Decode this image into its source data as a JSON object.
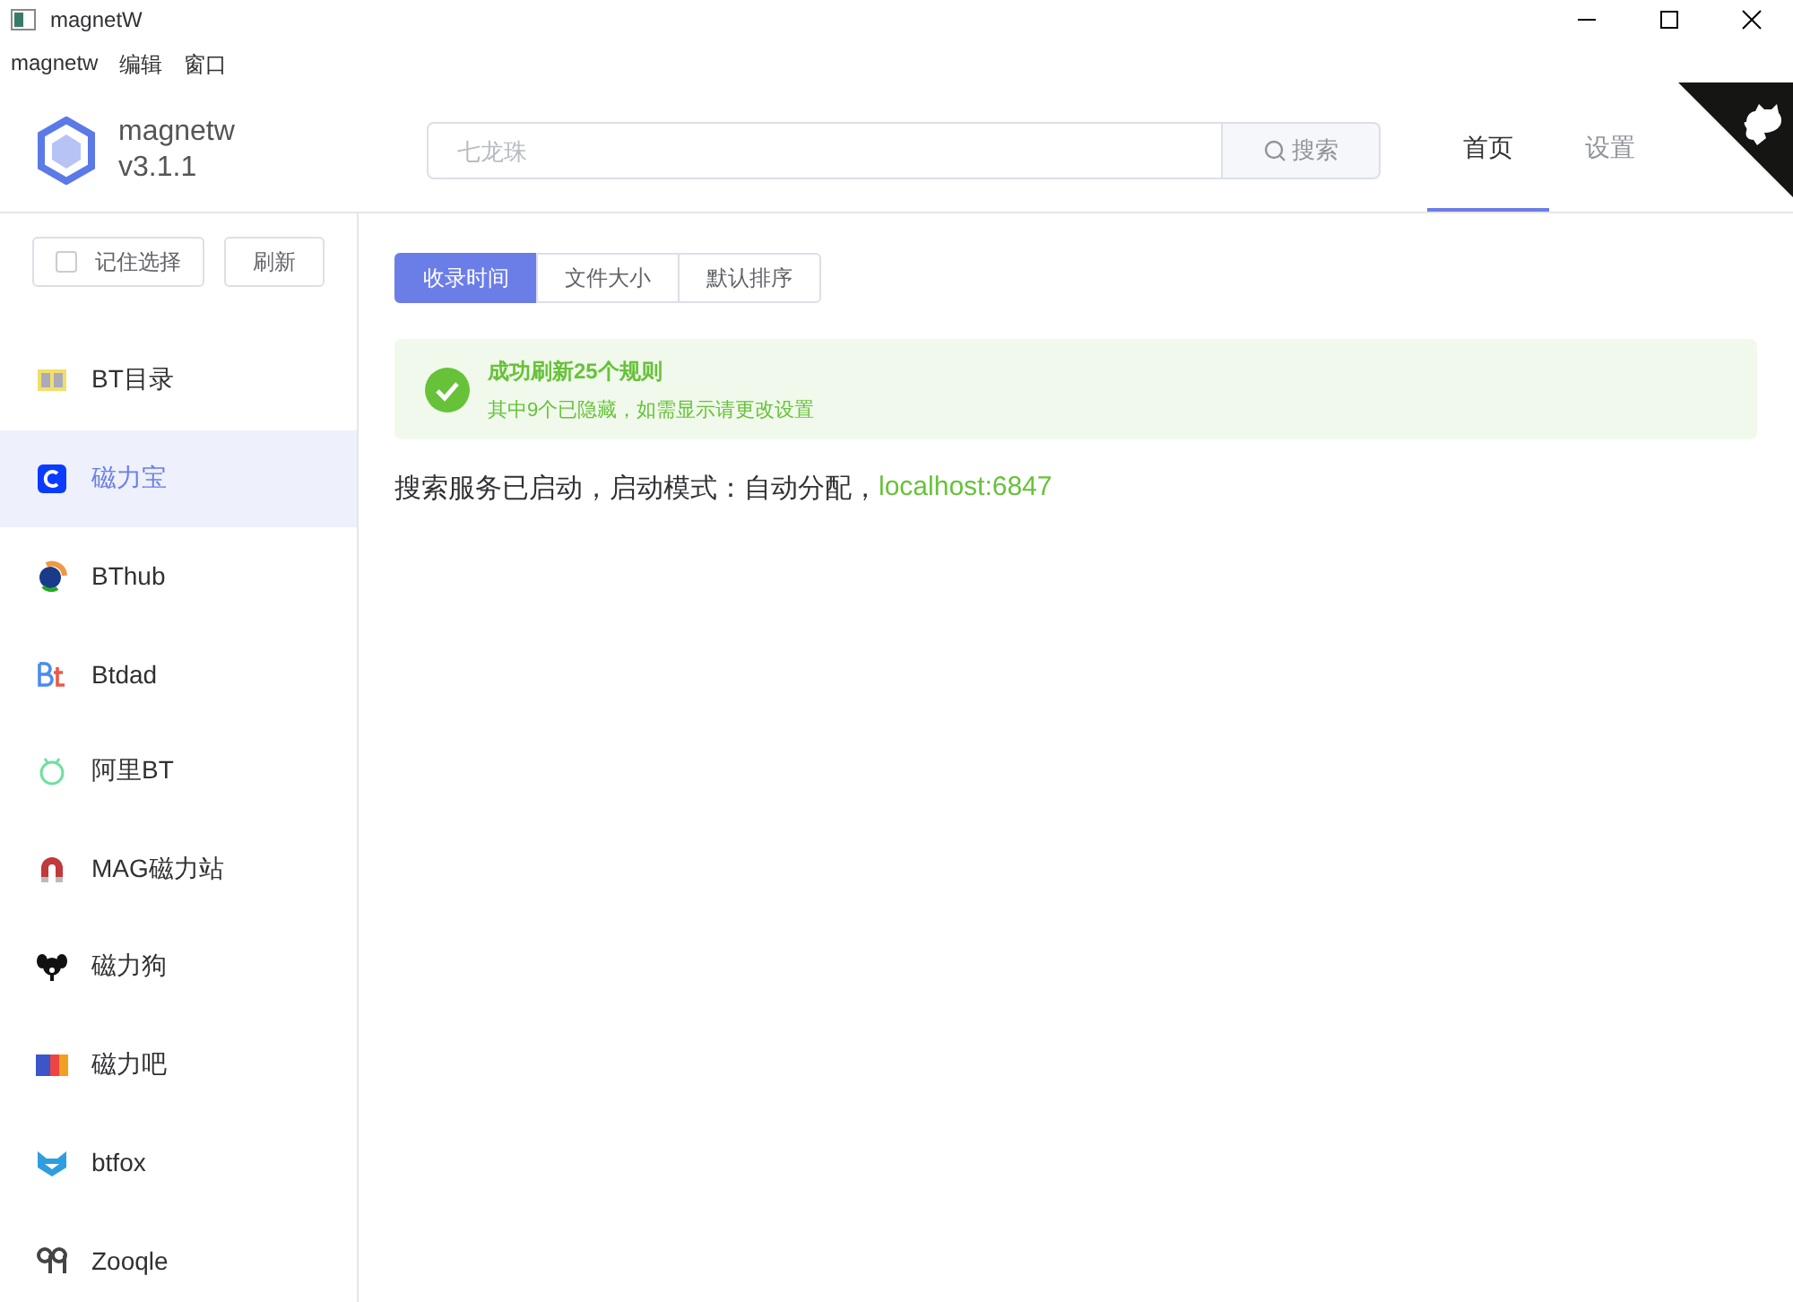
{
  "window": {
    "title": "magnetW"
  },
  "menu": [
    "magnetw",
    "编辑",
    "窗口"
  ],
  "app": {
    "name": "magnetw",
    "version": "v3.1.1"
  },
  "search": {
    "placeholder": "七龙珠",
    "button": "搜索"
  },
  "nav": [
    {
      "label": "首页",
      "selected": true
    },
    {
      "label": "设置",
      "selected": false
    }
  ],
  "sidebar": {
    "remember": {
      "label": "记住选择",
      "checked": false
    },
    "refresh": "刷新",
    "items": [
      {
        "label": "BT目录",
        "selected": false
      },
      {
        "label": "磁力宝",
        "selected": true
      },
      {
        "label": "BThub",
        "selected": false
      },
      {
        "label": "Btdad",
        "selected": false
      },
      {
        "label": "阿里BT",
        "selected": false
      },
      {
        "label": "MAG磁力站",
        "selected": false
      },
      {
        "label": "磁力狗",
        "selected": false
      },
      {
        "label": "磁力吧",
        "selected": false
      },
      {
        "label": "btfox",
        "selected": false
      },
      {
        "label": "Zooqle",
        "selected": false
      }
    ]
  },
  "sort": [
    {
      "label": "收录时间",
      "selected": true
    },
    {
      "label": "文件大小",
      "selected": false
    },
    {
      "label": "默认排序",
      "selected": false
    }
  ],
  "alert": {
    "title": "成功刷新25个规则",
    "description": "其中9个已隐藏，如需显示请更改设置"
  },
  "status": {
    "text": "搜索服务已启动，启动模式：自动分配，",
    "link": "localhost:6847"
  }
}
